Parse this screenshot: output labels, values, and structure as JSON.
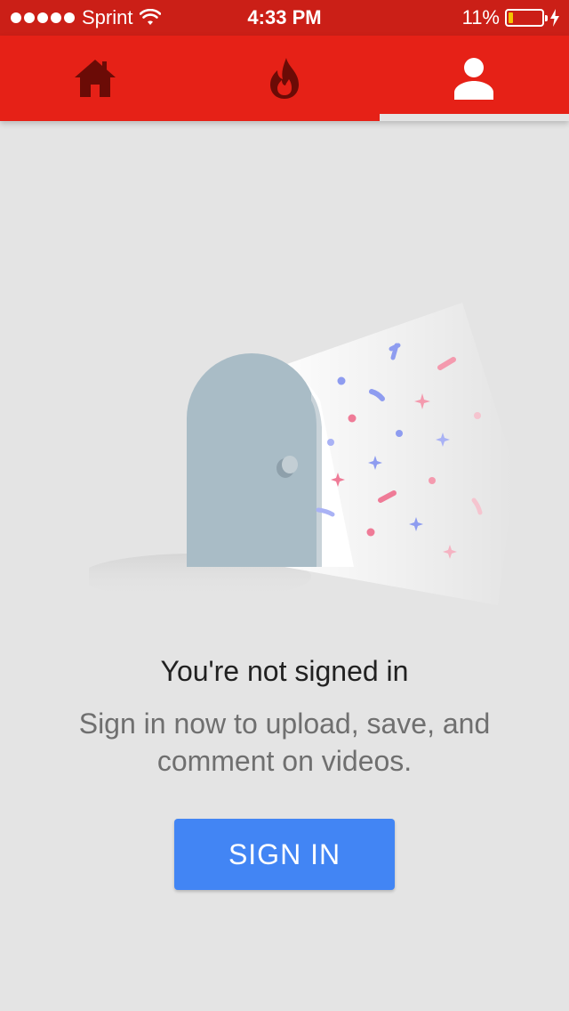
{
  "status_bar": {
    "carrier": "Sprint",
    "time": "4:33 PM",
    "battery_percent": "11%",
    "battery_level": 0.11,
    "signal_icon": "signal-dots-icon",
    "wifi_icon": "wifi-icon",
    "charging_icon": "bolt-icon"
  },
  "tabs": [
    {
      "icon": "home-icon",
      "active": false
    },
    {
      "icon": "trending-flame-icon",
      "active": false
    },
    {
      "icon": "account-icon",
      "active": true
    }
  ],
  "empty_state": {
    "title": "You're not signed in",
    "subtitle": "Sign in now to upload, save, and comment on videos.",
    "button_label": "SIGN IN",
    "illustration_icon": "open-door-confetti-illustration"
  },
  "colors": {
    "status_bar": "#cb1f17",
    "tab_bar": "#e62117",
    "background": "#e4e4e4",
    "button": "#4285f4"
  }
}
